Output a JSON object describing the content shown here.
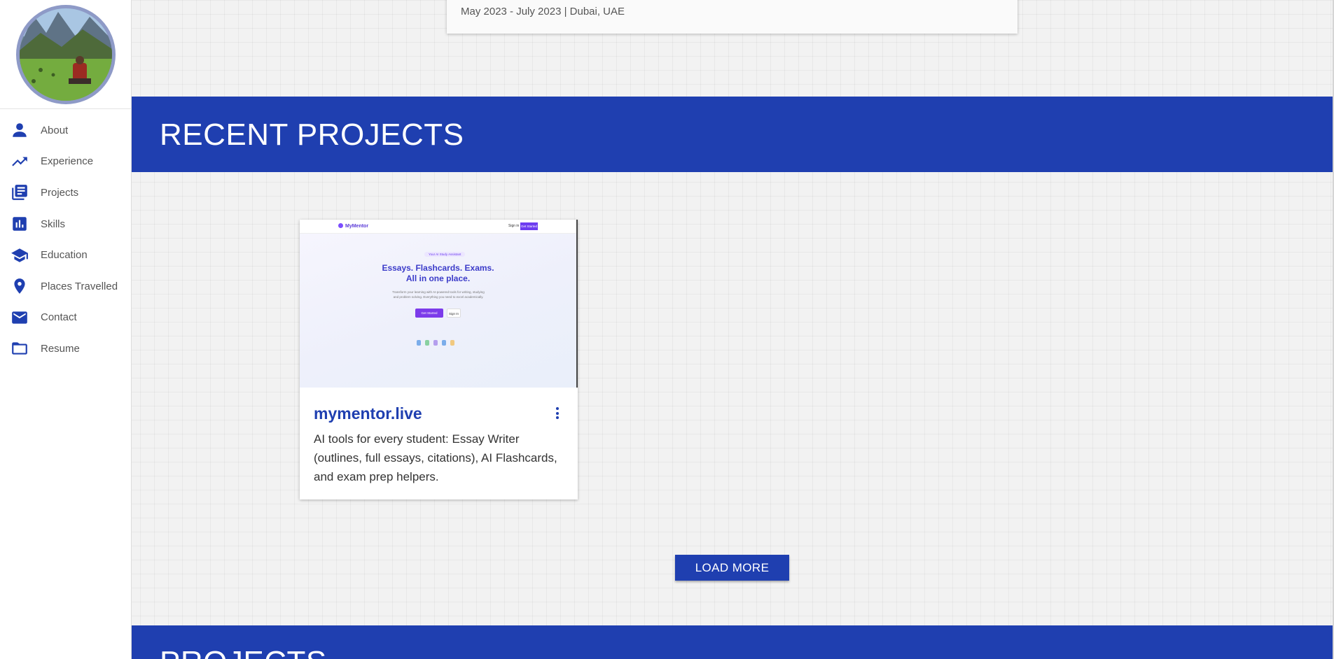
{
  "sidebar": {
    "items": [
      {
        "label": "About",
        "icon": "person-icon"
      },
      {
        "label": "Experience",
        "icon": "trending-up-icon"
      },
      {
        "label": "Projects",
        "icon": "library-books-icon"
      },
      {
        "label": "Skills",
        "icon": "bar-chart-icon"
      },
      {
        "label": "Education",
        "icon": "school-icon"
      },
      {
        "label": "Places Travelled",
        "icon": "location-pin-icon"
      },
      {
        "label": "Contact",
        "icon": "mail-icon"
      },
      {
        "label": "Resume",
        "icon": "folder-icon"
      }
    ]
  },
  "experience": {
    "meta": "May 2023 - July 2023 | Dubai, UAE"
  },
  "recent_projects": {
    "title": "RECENT PROJECTS",
    "projects": [
      {
        "title": "mymentor.live",
        "description": "AI tools for every student: Essay Writer (outlines, full essays, citations), AI Flashcards, and exam prep helpers.",
        "preview": {
          "logo": "MyMentor",
          "signin": "Sign in",
          "get_started": "Get Started",
          "pill": "Your AI Study Assistant",
          "headline_1": "Essays. Flashcards. Exams.",
          "headline_2": "All in one place.",
          "subtext": "Transform your learning with AI-powered tools for writing, studying and problem solving. Everything you need to excel academically.",
          "cta_primary": "Get Started",
          "cta_secondary": "Sign In"
        }
      }
    ],
    "load_more": "LOAD MORE"
  },
  "projects_section": {
    "title": "PROJECTS"
  },
  "colors": {
    "accent": "#1f3fb0",
    "background": "#f2f2f2"
  }
}
